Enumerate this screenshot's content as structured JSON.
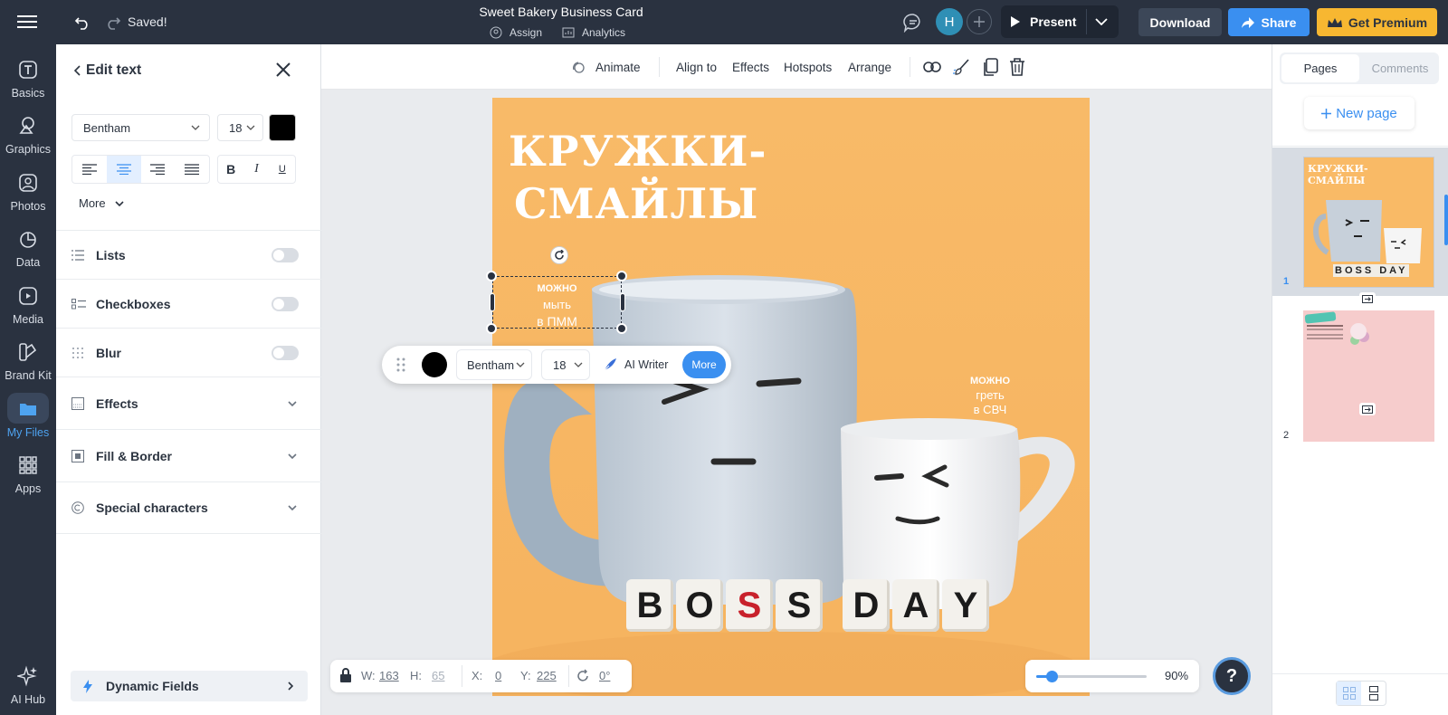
{
  "header": {
    "saved": "Saved!",
    "doc_title": "Sweet Bakery Business Card",
    "assign": "Assign",
    "analytics": "Analytics",
    "avatar_initial": "H",
    "present": "Present",
    "download": "Download",
    "share": "Share",
    "premium": "Get Premium"
  },
  "rail": {
    "items": [
      {
        "label": "Basics",
        "icon": "text-t-icon"
      },
      {
        "label": "Graphics",
        "icon": "shapes-icon"
      },
      {
        "label": "Photos",
        "icon": "photo-icon"
      },
      {
        "label": "Data",
        "icon": "pie-chart-icon"
      },
      {
        "label": "Media",
        "icon": "media-icon"
      },
      {
        "label": "Brand Kit",
        "icon": "brand-kit-icon"
      },
      {
        "label": "My Files",
        "icon": "folder-icon"
      },
      {
        "label": "Apps",
        "icon": "apps-grid-icon"
      }
    ],
    "ai_hub": "AI Hub",
    "active": "My Files"
  },
  "panel": {
    "title": "Edit text",
    "font": "Bentham",
    "size": "18",
    "color": "#000000",
    "bold": "B",
    "italic": "I",
    "underline": "U",
    "more": "More",
    "lists": "Lists",
    "checkboxes": "Checkboxes",
    "blur": "Blur",
    "effects": "Effects",
    "fill_border": "Fill & Border",
    "special_chars": "Special characters",
    "dynamic_fields": "Dynamic Fields"
  },
  "toolbar": {
    "animate": "Animate",
    "align_to": "Align to",
    "effects": "Effects",
    "hotspots": "Hotspots",
    "arrange": "Arrange"
  },
  "canvas": {
    "headline_1": "КРУЖКИ-",
    "headline_2": "СМАЙЛЫ",
    "sel_line1": "можно",
    "sel_line2": "мыть",
    "sel_line3": "в ПММ",
    "side_line1": "можно",
    "side_line2": "греть",
    "side_line3": "в СВЧ",
    "blocks": [
      "B",
      "O",
      "S",
      "S",
      "D",
      "A",
      "Y"
    ],
    "bg": "#f9ba66"
  },
  "floatbar": {
    "font": "Bentham",
    "size": "18",
    "ai_writer": "AI Writer",
    "more": "More"
  },
  "bottom": {
    "w_label": "W:",
    "w": "163",
    "h_label": "H:",
    "h": "65",
    "x_label": "X:",
    "x": "0",
    "y_label": "Y:",
    "y": "225",
    "rot": "0°",
    "zoom": "90%",
    "zoom_level": 0.14,
    "help": "?"
  },
  "rightpanel": {
    "tab_pages": "Pages",
    "tab_comments": "Comments",
    "new_page": "New page",
    "thumb1_title": "КРУЖКИ-\nСМАЙЛЫ",
    "thumb1_blocks": "BOSS DAY",
    "page1": "1",
    "page2": "2"
  }
}
